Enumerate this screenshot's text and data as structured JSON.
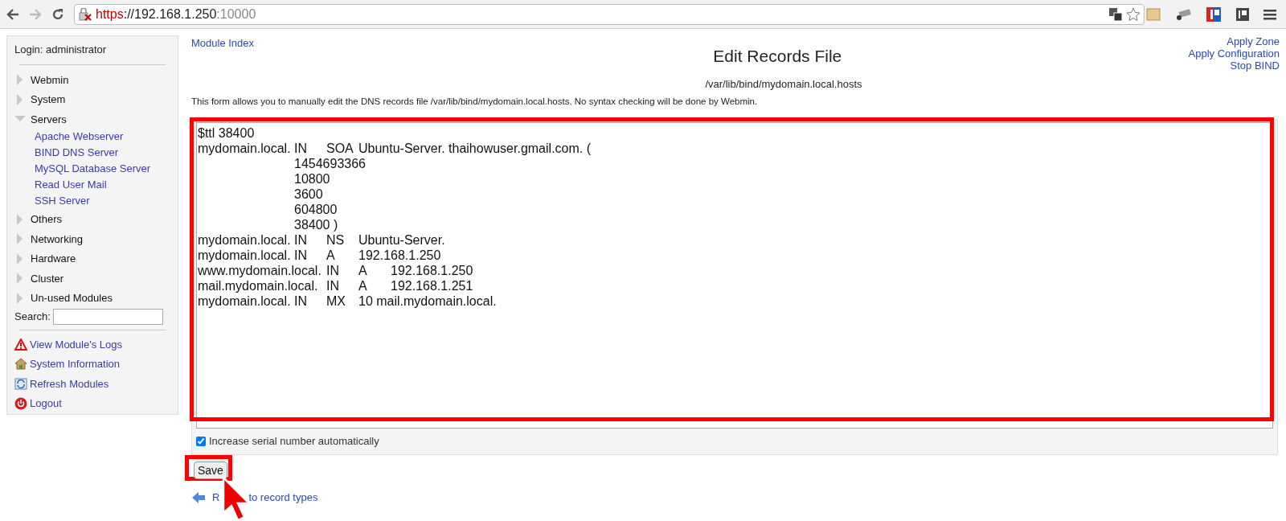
{
  "browser": {
    "url_scheme": "https",
    "url_host": "://192.168.1.250",
    "url_port": ":10000"
  },
  "sidebar": {
    "login": "Login: administrator",
    "categories": [
      {
        "label": "Webmin",
        "expanded": false
      },
      {
        "label": "System",
        "expanded": false
      },
      {
        "label": "Servers",
        "expanded": true,
        "children": [
          "Apache Webserver",
          "BIND DNS Server",
          "MySQL Database Server",
          "Read User Mail",
          "SSH Server"
        ]
      },
      {
        "label": "Others",
        "expanded": false
      },
      {
        "label": "Networking",
        "expanded": false
      },
      {
        "label": "Hardware",
        "expanded": false
      },
      {
        "label": "Cluster",
        "expanded": false
      },
      {
        "label": "Un-used Modules",
        "expanded": false
      }
    ],
    "search_label": "Search:",
    "links": [
      {
        "kind": "warning",
        "label": "View Module's Logs"
      },
      {
        "kind": "home",
        "label": "System Information"
      },
      {
        "kind": "refresh",
        "label": "Refresh Modules"
      },
      {
        "kind": "power",
        "label": "Logout"
      }
    ]
  },
  "main": {
    "module_index": "Module Index",
    "title": "Edit Records File",
    "subtitle": "/var/lib/bind/mydomain.local.hosts",
    "right_links": [
      "Apply Zone",
      "Apply Configuration",
      "Stop BIND"
    ],
    "description": "This form allows you to manually edit the DNS records file /var/lib/bind/mydomain.local.hosts. No syntax checking will be done by Webmin.",
    "records": [
      "$ttl 38400",
      "mydomain.local.\tIN\tSOA\tUbuntu-Server. thaihowuser.gmail.com. (",
      "\t\t\t1454693366",
      "\t\t\t10800",
      "\t\t\t3600",
      "\t\t\t604800",
      "\t\t\t38400 )",
      "mydomain.local.\tIN\tNS\tUbuntu-Server.",
      "mydomain.local.\tIN\tA\t192.168.1.250",
      "www.mydomain.local.\tIN\tA\t192.168.1.250",
      "mail.mydomain.local.\tIN\tA\t192.168.1.251",
      "mydomain.local.\tIN\tMX\t10 mail.mydomain.local."
    ],
    "increase_serial": {
      "label": "Increase serial number automatically",
      "checked": true
    },
    "save": "Save",
    "return_link": [
      "R",
      "to record types"
    ]
  }
}
